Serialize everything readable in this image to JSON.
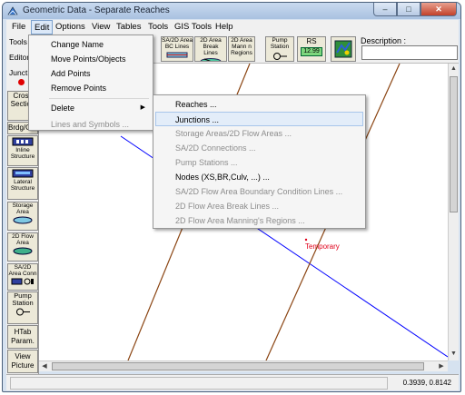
{
  "window": {
    "title": "Geometric Data - Separate Reaches",
    "minimize_label": "–",
    "maximize_label": "□",
    "close_label": "✕"
  },
  "menubar": {
    "items": [
      "File",
      "Edit",
      "Options",
      "View",
      "Tables",
      "Tools",
      "GIS Tools",
      "Help"
    ]
  },
  "toolbar": {
    "sa2d_area_bc_lines": "SA/2D Area BC Lines",
    "area_break_lines": "2D Area Break Lines",
    "area_mannings_regions": "2D Area Mann n Regions",
    "pump_station": "Pump Station",
    "rs_label": "RS",
    "rs_value": "12.99",
    "description_label": "Description :",
    "description_value": ""
  },
  "sidebar": {
    "tools_label": "Tools",
    "editors_label": "Editors",
    "junct_label": "Junct.",
    "cross_section": "Cross Section",
    "brdg_culv": "Brdg/Culv",
    "inline_structure": "Inline Structure",
    "lateral_structure": "Lateral Structure",
    "storage_area": "Storage Area",
    "flow_area_2d": "2D Flow Area",
    "sa2d_area_conn": "SA/2D Area Conn",
    "pump_station": "Pump Station",
    "htab_param": "HTab Param.",
    "view_picture": "View Picture"
  },
  "edit_menu": {
    "items": [
      {
        "label": "Change Name",
        "enabled": true
      },
      {
        "label": "Move Points/Objects",
        "enabled": true
      },
      {
        "label": "Add Points",
        "enabled": true
      },
      {
        "label": "Remove Points",
        "enabled": true
      },
      {
        "label": "Delete",
        "enabled": true,
        "submenu": true
      },
      {
        "label": "Lines and Symbols ...",
        "enabled": false
      }
    ]
  },
  "delete_submenu": {
    "items": [
      {
        "label": "Reaches ...",
        "enabled": true
      },
      {
        "label": "Junctions ...",
        "enabled": true,
        "highlighted": true
      },
      {
        "label": "Storage Areas/2D Flow Areas ...",
        "enabled": false
      },
      {
        "label": "SA/2D Connections ...",
        "enabled": false
      },
      {
        "label": "Pump Stations ...",
        "enabled": false
      },
      {
        "label": "Nodes (XS,BR,Culv, ...) ...",
        "enabled": true
      },
      {
        "label": "SA/2D Flow Area Boundary Condition Lines ...",
        "enabled": false
      },
      {
        "label": "2D Flow Area Break Lines ...",
        "enabled": false
      },
      {
        "label": "2D Flow Area Manning's Regions ...",
        "enabled": false
      }
    ]
  },
  "canvas": {
    "temporary_label": "Temporary"
  },
  "statusbar": {
    "coordinates": "0.3939, 0.8142"
  },
  "colors": {
    "river_line": "#0000ff",
    "cross_section_line": "#8b4513",
    "temporary_label": "#e0001a",
    "menu_highlight": "#e3edf9"
  }
}
